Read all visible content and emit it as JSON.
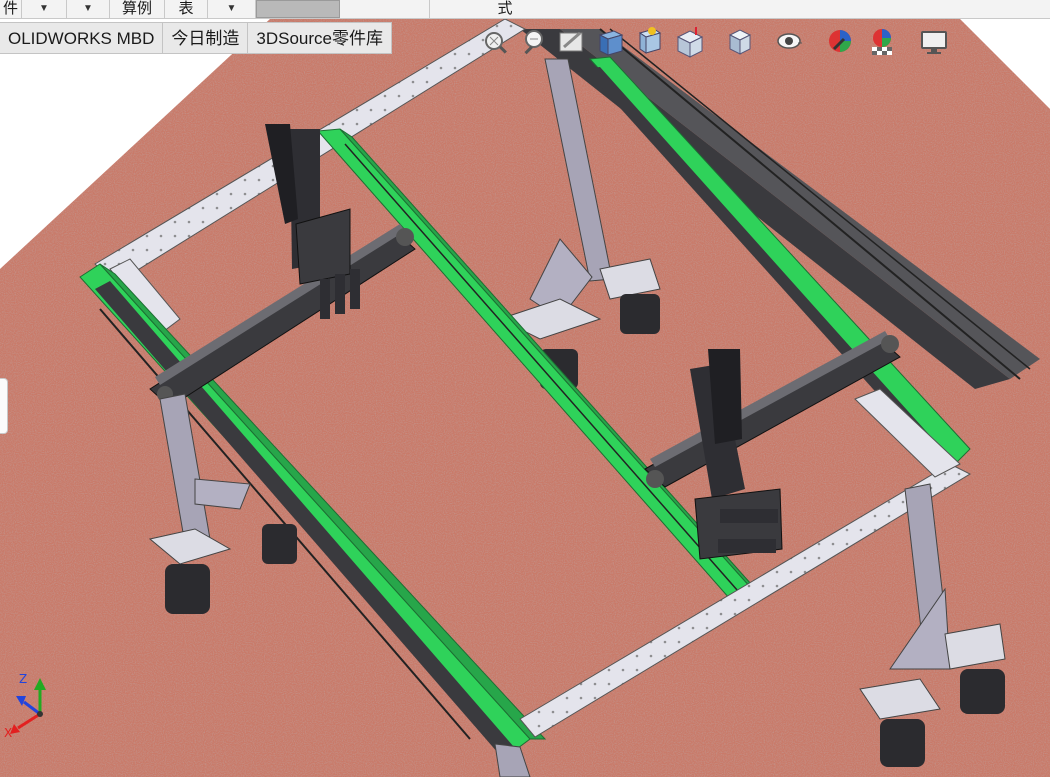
{
  "app": "SOLIDWORKS",
  "top_strip": {
    "left_glyph": "件",
    "dropdown_glyph": "▼",
    "item_1": "算例",
    "item_2": "表",
    "item_3": "式"
  },
  "tabs": [
    {
      "label": "OLIDWORKS MBD"
    },
    {
      "label": "今日制造"
    },
    {
      "label": "3DSource零件库"
    }
  ],
  "heads_up_toolbar": [
    {
      "icon": "zoom-to-fit-icon"
    },
    {
      "icon": "zoom-to-area-icon"
    },
    {
      "icon": "previous-view-icon"
    },
    {
      "icon": "section-view-icon"
    },
    {
      "icon": "dynamic-annotation-views-icon"
    },
    {
      "icon": "view-orientation-icon"
    },
    {
      "icon": "display-style-icon"
    },
    {
      "icon": "hide-show-items-icon"
    },
    {
      "icon": "edit-appearance-icon"
    },
    {
      "icon": "apply-scene-icon"
    },
    {
      "icon": "view-settings-icon"
    }
  ],
  "triad": {
    "y_label": "Z",
    "x_label": "X"
  },
  "colors": {
    "floor": "#c97a69",
    "frame_beam": "#e4e4ec",
    "rail_green": "#2fd25a",
    "dark_parts": "#2e2e33",
    "leg": "#a7a4b6",
    "axis_x": "#e22020",
    "axis_y": "#22aa22",
    "axis_z": "#2244dd"
  }
}
